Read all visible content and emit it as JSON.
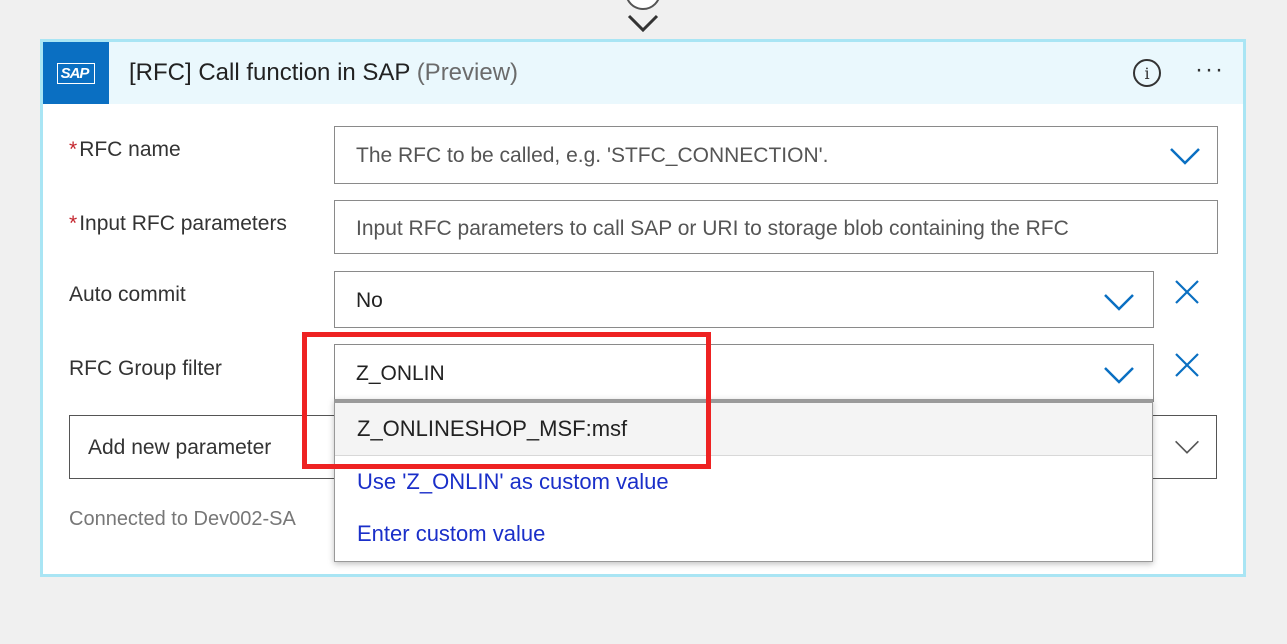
{
  "card": {
    "logo_text": "SAP",
    "title": "[RFC] Call function in SAP",
    "title_suffix": "(Preview)"
  },
  "fields": {
    "rfc_name": {
      "required_mark": "*",
      "label": "RFC name",
      "placeholder": "The RFC to be called, e.g. 'STFC_CONNECTION'."
    },
    "input_params": {
      "required_mark": "*",
      "label": "Input RFC parameters",
      "placeholder": "Input RFC parameters to call SAP or URI to storage blob containing the RFC"
    },
    "auto_commit": {
      "label": "Auto commit",
      "value": "No"
    },
    "rfc_group_filter": {
      "label": "RFC Group filter",
      "value": "Z_ONLIN"
    }
  },
  "add_parameter": {
    "label": "Add new parameter"
  },
  "connection": {
    "text": "Connected to Dev002-SA"
  },
  "dropdown": {
    "options": [
      "Z_ONLINESHOP_MSF:msf",
      "Use 'Z_ONLIN' as custom value",
      "Enter custom value"
    ]
  },
  "colors": {
    "accent": "#0a6fc2",
    "header_bg": "#eaf8fd",
    "card_border": "#a9e5f4",
    "link": "#1a2fc9",
    "highlight": "#ee2222"
  }
}
